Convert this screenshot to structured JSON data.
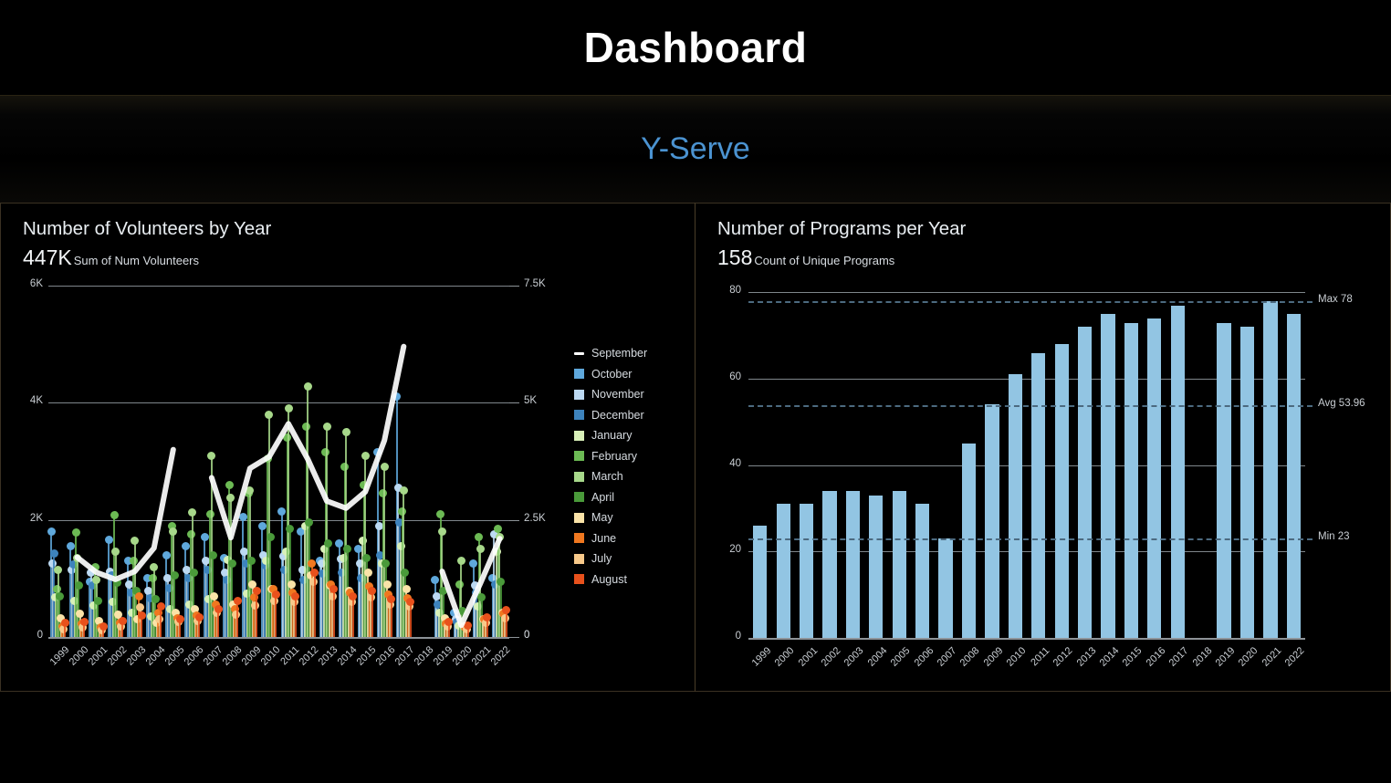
{
  "header": {
    "title": "Dashboard",
    "subtitle": "Y-Serve",
    "title_color": "#ffffff",
    "subtitle_color": "#4b93d1"
  },
  "charts": {
    "volunteers": {
      "title": "Number of Volunteers by Year",
      "kpi_value": "447K",
      "kpi_label": "Sum of Num Volunteers"
    },
    "programs": {
      "title": "Number of Programs per Year",
      "kpi_value": "158",
      "kpi_label": "Count of Unique Programs"
    }
  },
  "chart_data": [
    {
      "id": "volunteers-by-year",
      "type": "bar",
      "title": "Number of Volunteers by Year",
      "subtitle": "447K Sum of Num Volunteers",
      "xlabel": "",
      "ylabel": "",
      "grid": true,
      "legend_position": "right",
      "categories": [
        "1999",
        "2000",
        "2001",
        "2002",
        "2003",
        "2004",
        "2005",
        "2006",
        "2007",
        "2008",
        "2009",
        "2010",
        "2011",
        "2012",
        "2013",
        "2014",
        "2015",
        "2016",
        "2017",
        "2018",
        "2019",
        "2020",
        "2021",
        "2022"
      ],
      "y_axis_left": {
        "ticks": [
          "0",
          "2K",
          "4K",
          "6K"
        ],
        "tick_values": [
          0,
          2000,
          4000,
          6000
        ],
        "ylim": [
          0,
          6000
        ]
      },
      "y_axis_right": {
        "ticks": [
          "0",
          "2.5K",
          "5K",
          "7.5K"
        ],
        "tick_values": [
          0,
          2500,
          5000,
          7500
        ],
        "ylim": [
          0,
          7500
        ]
      },
      "series": [
        {
          "name": "September",
          "type": "line",
          "color": "#ffffff",
          "axis": "right",
          "values": [
            null,
            1700,
            1380,
            1230,
            1400,
            1900,
            4000,
            null,
            3400,
            2120,
            3600,
            3850,
            4550,
            3800,
            2900,
            2750,
            3100,
            4200,
            6200,
            null,
            1400,
            250,
            1150,
            2100
          ]
        },
        {
          "name": "October",
          "type": "lollipop",
          "color": "#5fa8dc",
          "axis": "left",
          "values": [
            1800,
            1550,
            950,
            1660,
            1300,
            1000,
            1400,
            1550,
            1700,
            1350,
            2050,
            1900,
            2150,
            1800,
            1300,
            1600,
            1500,
            3150,
            4100,
            null,
            980,
            420,
            1250,
            1000
          ]
        },
        {
          "name": "November",
          "type": "lollipop",
          "color": "#bcd9f2",
          "axis": "left",
          "values": [
            1250,
            1150,
            1100,
            1120,
            900,
            780,
            1000,
            1150,
            1300,
            1100,
            1450,
            1400,
            1380,
            1150,
            1250,
            1330,
            1250,
            1900,
            2550,
            null,
            700,
            300,
            880,
            1750
          ]
        },
        {
          "name": "December",
          "type": "lollipop",
          "color": "#3d83bd",
          "axis": "left",
          "values": [
            1420,
            1240,
            880,
            1050,
            760,
            660,
            830,
            1000,
            1150,
            980,
            1250,
            1230,
            1150,
            980,
            1080,
            1100,
            1000,
            1400,
            1950,
            null,
            560,
            260,
            760,
            900
          ]
        },
        {
          "name": "January",
          "type": "lollipop",
          "color": "#d8f0b8",
          "axis": "left",
          "values": [
            680,
            620,
            540,
            600,
            420,
            350,
            480,
            560,
            640,
            1320,
            740,
            1300,
            1450,
            1900,
            1500,
            1350,
            1650,
            1250,
            1550,
            null,
            420,
            200,
            520,
            1450
          ]
        },
        {
          "name": "February",
          "type": "lollipop",
          "color": "#6cba54",
          "axis": "left",
          "values": [
            820,
            1780,
            1200,
            2080,
            1300,
            1000,
            1900,
            1750,
            2100,
            2600,
            2450,
            3050,
            3400,
            3600,
            3150,
            2900,
            2600,
            2450,
            2150,
            null,
            2100,
            900,
            1700,
            1850
          ]
        },
        {
          "name": "March",
          "type": "lollipop",
          "color": "#a7d88a",
          "axis": "left",
          "values": [
            1150,
            1350,
            980,
            1450,
            1650,
            1200,
            1800,
            2120,
            3100,
            2380,
            2500,
            3800,
            3900,
            4280,
            3600,
            3500,
            3100,
            2900,
            2500,
            null,
            1800,
            1300,
            1500,
            1700
          ]
        },
        {
          "name": "April",
          "type": "lollipop",
          "color": "#4a9a3a",
          "axis": "left",
          "values": [
            700,
            880,
            620,
            920,
            780,
            640,
            1050,
            1100,
            1400,
            1250,
            1300,
            1700,
            1850,
            1950,
            1600,
            1500,
            1350,
            1250,
            1100,
            null,
            780,
            450,
            680,
            950
          ]
        },
        {
          "name": "May",
          "type": "lollipop",
          "color": "#fae3a8",
          "axis": "left",
          "values": [
            320,
            400,
            280,
            380,
            300,
            240,
            420,
            480,
            700,
            560,
            900,
            820,
            900,
            1050,
            880,
            780,
            1100,
            900,
            820,
            null,
            320,
            180,
            300,
            420
          ]
        },
        {
          "name": "June",
          "type": "lollipop",
          "color": "#f07820",
          "axis": "left",
          "values": [
            180,
            220,
            160,
            240,
            700,
            420,
            320,
            360,
            560,
            480,
            680,
            820,
            760,
            1250,
            900,
            760,
            860,
            720,
            660,
            null,
            220,
            160,
            300,
            400
          ]
        },
        {
          "name": "July",
          "type": "lollipop",
          "color": "#f8c98a",
          "axis": "left",
          "values": [
            140,
            170,
            120,
            180,
            500,
            300,
            250,
            280,
            420,
            380,
            540,
            620,
            600,
            950,
            700,
            600,
            680,
            560,
            520,
            null,
            180,
            140,
            240,
            320
          ]
        },
        {
          "name": "August",
          "type": "lollipop",
          "color": "#e8511c",
          "axis": "left",
          "values": [
            240,
            260,
            180,
            280,
            360,
            520,
            300,
            330,
            480,
            620,
            780,
            720,
            700,
            1100,
            820,
            700,
            780,
            640,
            600,
            null,
            260,
            200,
            340,
            460
          ]
        }
      ],
      "legend": [
        {
          "label": "September",
          "color": "#ffffff",
          "marker": "line"
        },
        {
          "label": "October",
          "color": "#5fa8dc",
          "marker": "square"
        },
        {
          "label": "November",
          "color": "#bcd9f2",
          "marker": "square"
        },
        {
          "label": "December",
          "color": "#3d83bd",
          "marker": "square"
        },
        {
          "label": "January",
          "color": "#d8f0b8",
          "marker": "square"
        },
        {
          "label": "February",
          "color": "#6cba54",
          "marker": "square"
        },
        {
          "label": "March",
          "color": "#a7d88a",
          "marker": "square"
        },
        {
          "label": "April",
          "color": "#4a9a3a",
          "marker": "square"
        },
        {
          "label": "May",
          "color": "#fae3a8",
          "marker": "square"
        },
        {
          "label": "June",
          "color": "#f07820",
          "marker": "square"
        },
        {
          "label": "July",
          "color": "#f8c98a",
          "marker": "square"
        },
        {
          "label": "August",
          "color": "#e8511c",
          "marker": "square"
        }
      ]
    },
    {
      "id": "programs-per-year",
      "type": "bar",
      "title": "Number of Programs per Year",
      "subtitle": "158 Count of Unique Programs",
      "xlabel": "",
      "ylabel": "",
      "grid": true,
      "legend_position": "none",
      "bar_color": "#92c5e3",
      "categories": [
        "1999",
        "2000",
        "2001",
        "2002",
        "2003",
        "2004",
        "2005",
        "2006",
        "2007",
        "2008",
        "2009",
        "2010",
        "2011",
        "2012",
        "2013",
        "2014",
        "2015",
        "2016",
        "2017",
        "2018",
        "2019",
        "2020",
        "2021",
        "2022"
      ],
      "values": [
        26,
        31,
        31,
        34,
        34,
        33,
        34,
        31,
        23,
        45,
        54,
        61,
        66,
        68,
        72,
        75,
        73,
        74,
        77,
        null,
        73,
        72,
        78,
        75
      ],
      "y_axis": {
        "ticks": [
          "0",
          "20",
          "40",
          "60",
          "80"
        ],
        "tick_values": [
          0,
          20,
          40,
          60,
          80
        ],
        "ylim": [
          0,
          82
        ]
      },
      "reference_lines": [
        {
          "label": "Max 78",
          "value": 78,
          "style": "dashed",
          "color": "#4c6a80"
        },
        {
          "label": "Avg 53.96",
          "value": 53.96,
          "style": "dashed",
          "color": "#4c6a80"
        },
        {
          "label": "Min 23",
          "value": 23,
          "style": "dashed",
          "color": "#4c6a80"
        }
      ]
    }
  ]
}
